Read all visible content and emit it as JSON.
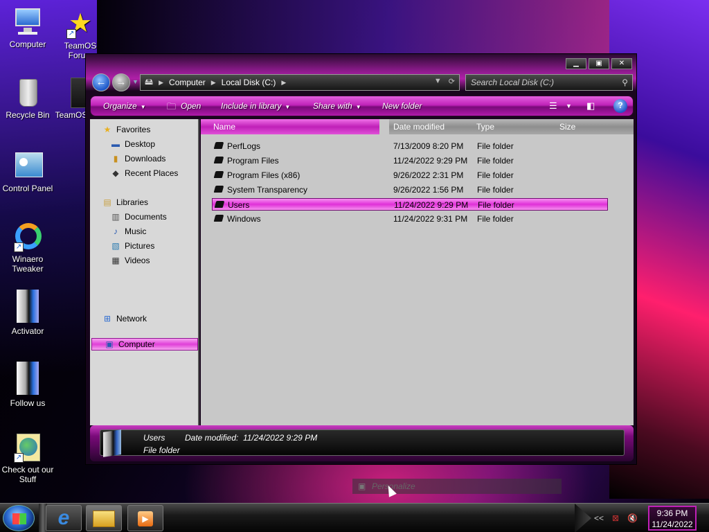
{
  "desktop": {
    "icons": [
      {
        "label": "Computer",
        "icon": "computer-icon"
      },
      {
        "label": "TeamOS Forum",
        "icon": "star-icon"
      },
      {
        "label": "Recycle Bin",
        "icon": "recycle-bin-icon"
      },
      {
        "label": "TeamOS",
        "icon": "app-icon"
      },
      {
        "label": "Control Panel",
        "icon": "control-panel-icon"
      },
      {
        "label": "Winaero Tweaker",
        "icon": "winaero-icon"
      },
      {
        "label": "Activator",
        "icon": "activator-icon"
      },
      {
        "label": "Follow us",
        "icon": "follow-icon"
      },
      {
        "label": "Check out our Stuff",
        "icon": "globe-icon"
      }
    ]
  },
  "window": {
    "address": {
      "crumbs": [
        "Computer",
        "Local Disk (C:)"
      ]
    },
    "search_placeholder": "Search Local Disk (C:)",
    "toolbar": {
      "organize": "Organize",
      "open": "Open",
      "include": "Include in library",
      "share": "Share with",
      "new_folder": "New folder"
    },
    "nav": {
      "favorites": "Favorites",
      "desktop": "Desktop",
      "downloads": "Downloads",
      "recent": "Recent Places",
      "libraries": "Libraries",
      "documents": "Documents",
      "music": "Music",
      "pictures": "Pictures",
      "videos": "Videos",
      "computer": "Computer",
      "network": "Network"
    },
    "columns": {
      "name": "Name",
      "date": "Date modified",
      "type": "Type",
      "size": "Size"
    },
    "files": [
      {
        "name": "PerfLogs",
        "date": "7/13/2009 8:20 PM",
        "type": "File folder"
      },
      {
        "name": "Program Files",
        "date": "11/24/2022 9:29 PM",
        "type": "File folder"
      },
      {
        "name": "Program Files (x86)",
        "date": "9/26/2022 2:31 PM",
        "type": "File folder"
      },
      {
        "name": "System Transparency",
        "date": "9/26/2022 1:56 PM",
        "type": "File folder"
      },
      {
        "name": "Users",
        "date": "11/24/2022 9:29 PM",
        "type": "File folder"
      },
      {
        "name": "Windows",
        "date": "11/24/2022 9:31 PM",
        "type": "File folder"
      }
    ],
    "details": {
      "name": "Users",
      "date_label": "Date modified:",
      "date_value": "11/24/2022 9:29 PM",
      "type": "File folder"
    }
  },
  "personalize": "Personalize",
  "taskbar": {
    "time": "9:36 PM",
    "date": "11/24/2022",
    "overflow": "<<"
  },
  "colors": {
    "accent": "#e030d8",
    "accent_dark": "#7a0a7a"
  }
}
